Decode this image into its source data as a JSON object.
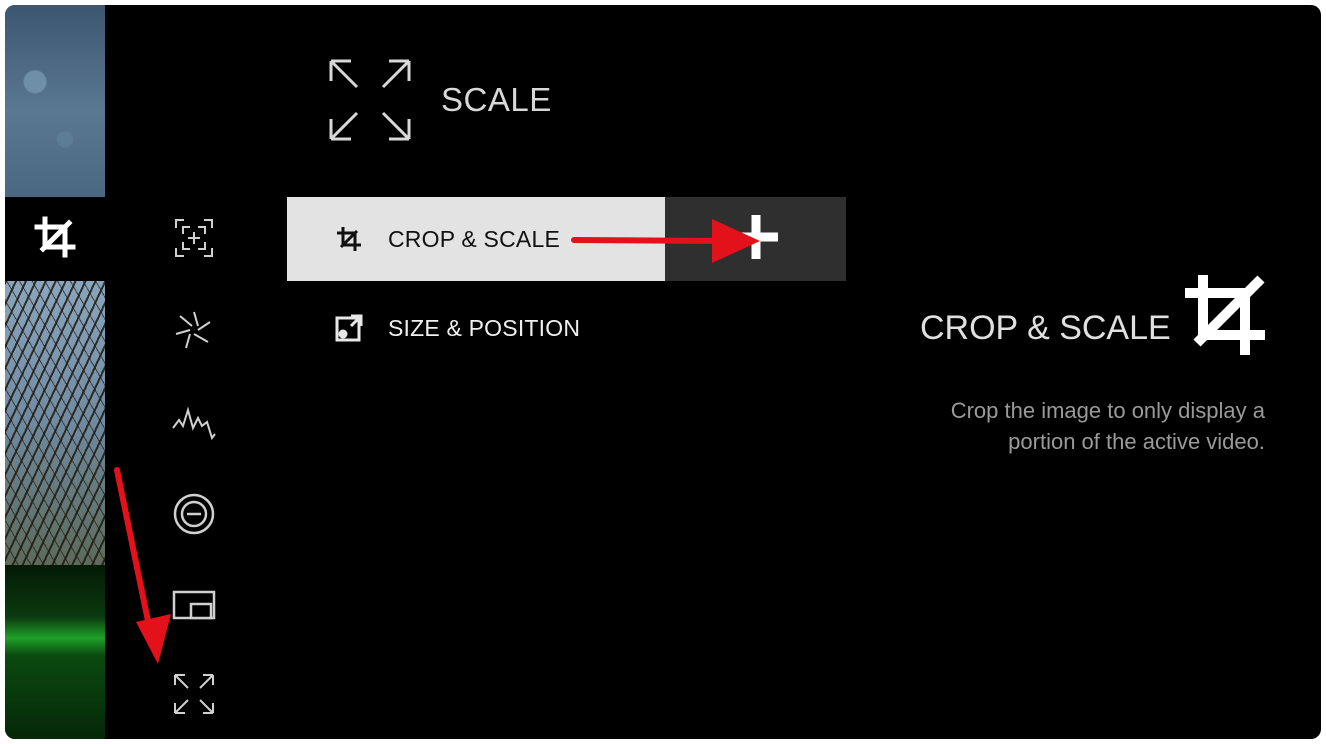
{
  "header": {
    "title": "SCALE",
    "icon": "expand-icon"
  },
  "menu": {
    "items": [
      {
        "label": "CROP & SCALE",
        "icon": "crop-icon",
        "selected": true,
        "action_icon": "plus-icon"
      },
      {
        "label": "SIZE & POSITION",
        "icon": "size-position-icon",
        "selected": false
      }
    ]
  },
  "sidebar": {
    "selected_icon": "crop-icon",
    "tools": [
      "focus-assist-icon",
      "aperture-icon",
      "waveform-icon",
      "zoom-out-icon",
      "picture-in-picture-icon",
      "expand-icon"
    ]
  },
  "info": {
    "title": "CROP & SCALE",
    "description_line1": "Crop the image to only display a",
    "description_line2": "portion of the active video.",
    "icon": "crop-icon"
  },
  "annotations": {
    "arrow_color": "#e3111a"
  }
}
